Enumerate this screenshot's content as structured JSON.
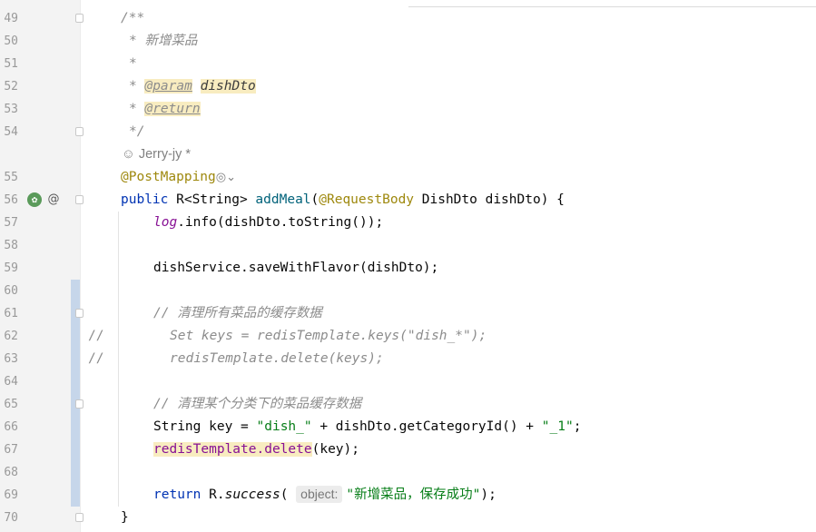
{
  "editor": {
    "line_numbers": [
      "49",
      "50",
      "51",
      "52",
      "53",
      "54",
      "55",
      "56",
      "57",
      "58",
      "59",
      "60",
      "61",
      "62",
      "63",
      "64",
      "65",
      "66",
      "67",
      "68",
      "69",
      "70"
    ],
    "lines": {
      "l49": "/**",
      "l50": "* 新增菜品",
      "l51": "*",
      "l52_star": "* ",
      "l52_tag": "@param",
      "l52_name": "dishDto",
      "l53_star": "* ",
      "l53_tag": "@return",
      "l54": "*/",
      "author": "Jerry-jy *",
      "l55_ann": "@PostMapping",
      "l56_kw": "public",
      "l56_type": " R<String> ",
      "l56_fn": "addMeal",
      "l56_paren": "(",
      "l56_ann": "@RequestBody",
      "l56_rest": " DishDto dishDto",
      "l56_close": ")",
      "l56_brace": " {",
      "l57_static": "log",
      "l57_rest": ".info(dishDto.toString());",
      "l59": "dishService.saveWithFlavor(dishDto);",
      "l61": "// 清理所有菜品的缓存数据",
      "l62_prefix": "//",
      "l62": "Set keys = redisTemplate.keys(\"dish_*\");",
      "l63_prefix": "//",
      "l63": "redisTemplate.delete(keys);",
      "l65": "// 清理某个分类下的菜品缓存数据",
      "l66_a": "String key = ",
      "l66_s1": "\"dish_\"",
      "l66_b": " + dishDto.getCategoryId() + ",
      "l66_s2": "\"_1\"",
      "l66_c": ";",
      "l67_hl": "redisTemplate.delete",
      "l67_rest": "(key);",
      "l69_kw": "return",
      "l69_a": " R.",
      "l69_fn": "success",
      "l69_paren": "(",
      "l69_hint": "object:",
      "l69_str": "\"新增菜品，保存成功\"",
      "l69_end": ");",
      "l70": "}"
    }
  },
  "icons": {
    "bean": "bean-icon",
    "override": "at-sign-icon",
    "web": "globe-dropdown-icon"
  },
  "colors": {
    "keyword": "#0033b3",
    "string": "#067d17",
    "annotation": "#9e880d",
    "comment": "#8c8c8c"
  }
}
